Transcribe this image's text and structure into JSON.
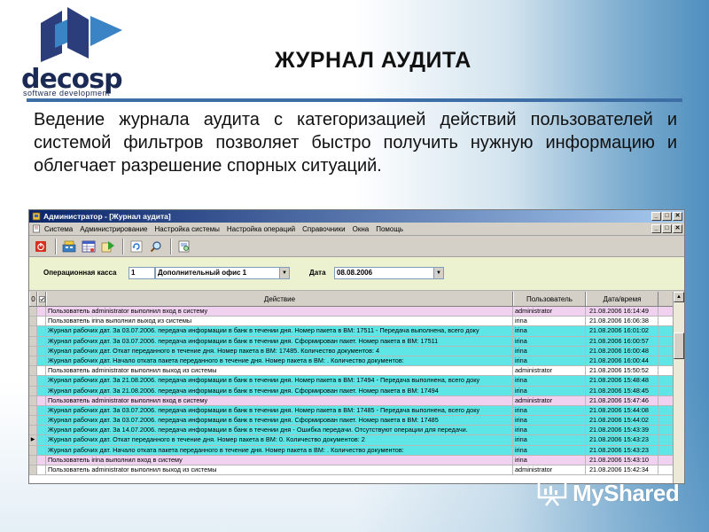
{
  "slide": {
    "title": "ЖУРНАЛ АУДИТА",
    "body": "Ведение журнала аудита с категоризацией действий пользователей и системой фильтров позволяет быстро получить нужную информацию и облегчает разрешение спорных ситуаций.",
    "logo": {
      "word": "decosp",
      "sub": "software development"
    }
  },
  "window": {
    "title": "Администратор - [Журнал аудита]",
    "controls": [
      "_",
      "□",
      "✕"
    ],
    "menu": [
      "Система",
      "Администрирование",
      "Настройка системы",
      "Настройка операций",
      "Справочники",
      "Окна",
      "Помощь"
    ]
  },
  "filters": {
    "office_label": "Операционная касса",
    "office_code": "1",
    "office_name": "Дополнительный офис 1",
    "date_label": "Дата",
    "date_value": "08.08.2006"
  },
  "grid": {
    "headers": {
      "action": "Действие",
      "user": "Пользователь",
      "datetime": "Дата/время"
    },
    "rows": [
      {
        "action": "Пользователь administrator выполнил вход в систему",
        "user": "administrator",
        "datetime": "21.08.2006 16:14:49",
        "color": "#f0d2f0"
      },
      {
        "action": "Пользователь irina выполнил выход из системы",
        "user": "irina",
        "datetime": "21.08.2006 16:06:38",
        "color": "#ffffff"
      },
      {
        "action": "Журнал рабочих дат. За 03.07.2006. передача информации в банк в течении дня. Номер пакета в ВМ: 17511 - Передача выполнена, всего доку",
        "user": "irina",
        "datetime": "21.08.2006 16:01:02",
        "color": "#5ee6e6"
      },
      {
        "action": "Журнал рабочих дат. За 03.07.2006. передача информации в банк в течении дня. Сформирован пакет. Номер пакета в ВМ: 17511",
        "user": "irina",
        "datetime": "21.08.2006 16:00:57",
        "color": "#5ee6e6"
      },
      {
        "action": "Журнал рабочих дат. Откат переданного в течение дня. Номер пакета в ВМ: 17485. Количество документов: 4",
        "user": "irina",
        "datetime": "21.08.2006 16:00:48",
        "color": "#5ee6e6"
      },
      {
        "action": "Журнал рабочих дат. Начало отката пакета переданного в течение дня. Номер пакета в ВМ: . Количество документов:",
        "user": "irina",
        "datetime": "21.08.2006 16:00:44",
        "color": "#5ee6e6"
      },
      {
        "action": "Пользователь administrator выполнил выход из системы",
        "user": "administrator",
        "datetime": "21.08.2006 15:50:52",
        "color": "#ffffff"
      },
      {
        "action": "Журнал рабочих дат. За 21.08.2006. передача информации в банк в течении дня. Номер пакета в ВМ: 17494 - Передача выполнена, всего доку",
        "user": "irina",
        "datetime": "21.08.2006 15:48:48",
        "color": "#5ee6e6"
      },
      {
        "action": "Журнал рабочих дат. За 21.08.2006. передача информации в банк в течении дня. Сформирован пакет. Номер пакета в ВМ: 17494",
        "user": "irina",
        "datetime": "21.08.2006 15:48:45",
        "color": "#5ee6e6"
      },
      {
        "action": "Пользователь administrator выполнил вход в систему",
        "user": "administrator",
        "datetime": "21.08.2006 15:47:46",
        "color": "#f0d2f0"
      },
      {
        "action": "Журнал рабочих дат. За 03.07.2006. передача информации в банк в течении дня. Номер пакета в ВМ: 17485 - Передача выполнена, всего доку",
        "user": "irina",
        "datetime": "21.08.2006 15:44:08",
        "color": "#5ee6e6"
      },
      {
        "action": "Журнал рабочих дат. За 03.07.2006. передача информации в банк в течении дня. Сформирован пакет. Номер пакета в ВМ: 17485",
        "user": "irina",
        "datetime": "21.08.2006 15:44:02",
        "color": "#5ee6e6"
      },
      {
        "action": "Журнал рабочих дат. За 14.07.2006. передача информации в банк в течении дня - Ошибка передачи. Отсутствуют операции для передачи.",
        "user": "irina",
        "datetime": "21.08.2006 15:43:39",
        "color": "#5ee6e6"
      },
      {
        "action": "Журнал рабочих дат. Откат переданного в течение дня. Номер пакета в ВМ: 0. Количество документов: 2",
        "user": "irina",
        "datetime": "21.08.2006 15:43:23",
        "color": "#5ee6e6"
      },
      {
        "action": "Журнал рабочих дат. Начало отката пакета переданного в течение дня. Номер пакета в ВМ: . Количество документов:",
        "user": "irina",
        "datetime": "21.08.2006 15:43:23",
        "color": "#5ee6e6"
      },
      {
        "action": "Пользователь irina выполнил вход в систему",
        "user": "irina",
        "datetime": "21.08.2006 15:43:10",
        "color": "#f0d2f0"
      },
      {
        "action": "Пользователь administrator выполнил выход из системы",
        "user": "administrator",
        "datetime": "21.08.2006 15:42:34",
        "color": "#ffffff"
      }
    ],
    "current_row_marker": "▶"
  },
  "watermark": "MyShared",
  "colors": {
    "accent_rule": "#3d6fa6",
    "title_bar": "#0a246a",
    "filter_bg": "#ecf2cf",
    "cyan_row": "#5ee6e6",
    "pink_row": "#f0d2f0"
  }
}
